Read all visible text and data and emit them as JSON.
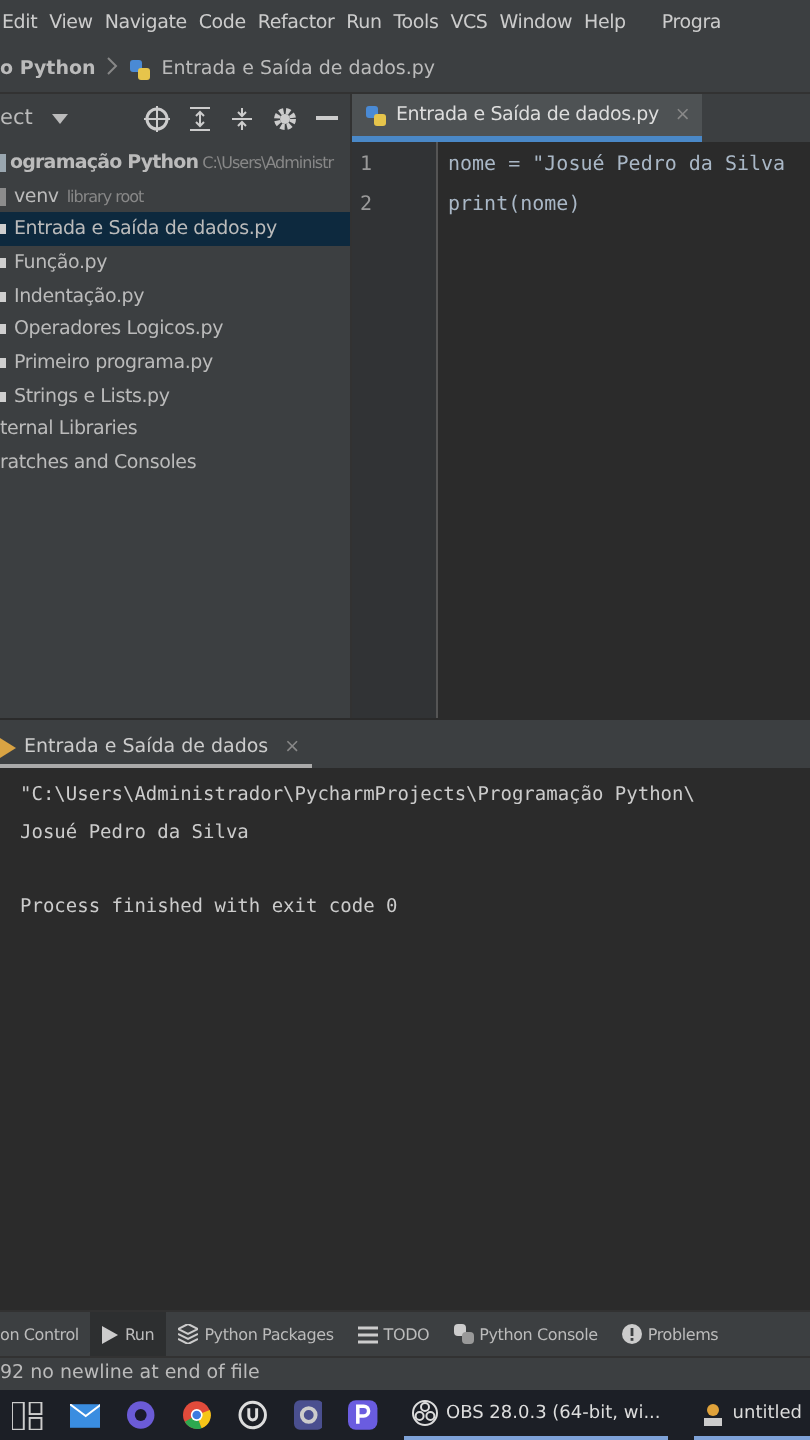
{
  "menu": [
    "Edit",
    "View",
    "Navigate",
    "Code",
    "Refactor",
    "Run",
    "Tools",
    "VCS",
    "Window",
    "Help",
    "Progra"
  ],
  "breadcrumb": {
    "project": "o Python",
    "file": "Entrada e Saída de dados.py"
  },
  "project_panel": {
    "dropdown": "ect",
    "tree": [
      {
        "label": "ogramação Python",
        "hint": "C:\\Users\\Administr",
        "kind": "folder",
        "expanded": true,
        "selected": false,
        "children": [
          {
            "label": "venv",
            "hint": "library root",
            "kind": "folder",
            "expanded": false,
            "selected": false
          },
          {
            "label": "Entrada e Saída de dados.py",
            "kind": "file",
            "selected": true
          },
          {
            "label": "Função.py",
            "kind": "file",
            "selected": false
          },
          {
            "label": "Indentação.py",
            "kind": "file",
            "selected": false
          },
          {
            "label": "Operadores Logicos.py",
            "kind": "file",
            "selected": false
          },
          {
            "label": "Primeiro programa.py",
            "kind": "file",
            "selected": false
          },
          {
            "label": "Strings e Lists.py",
            "kind": "file",
            "selected": false
          }
        ]
      },
      {
        "label": "ternal Libraries",
        "kind": "plain",
        "selected": false
      },
      {
        "label": "ratches and Consoles",
        "kind": "plain",
        "selected": false
      }
    ]
  },
  "editor": {
    "tab": "Entrada e Saída de dados.py",
    "close": "×",
    "lines": [
      {
        "number": "1",
        "code": "nome = \"Josué Pedro da Silva"
      },
      {
        "number": "2",
        "code": "print(nome)"
      }
    ]
  },
  "run_panel": {
    "tab": "Entrada e Saída de dados",
    "close": "×",
    "output": [
      "\"C:\\Users\\Administrador\\PycharmProjects\\Programação Python\\",
      "Josué Pedro da Silva",
      "Process finished with exit code 0"
    ]
  },
  "tool_tabs": [
    {
      "label": "on Control",
      "kind": "none",
      "selected": false
    },
    {
      "label": "Run",
      "kind": "run",
      "selected": true
    },
    {
      "label": "Python Packages",
      "kind": "layers",
      "selected": false
    },
    {
      "label": "TODO",
      "kind": "list",
      "selected": false
    },
    {
      "label": "Python Console",
      "kind": "python",
      "selected": false
    },
    {
      "label": "Problems",
      "kind": "alert",
      "selected": false
    }
  ],
  "status_bar": "92 no newline at end of file",
  "taskbar": {
    "windows": [
      {
        "label": "OBS 28.0.3 (64-bit, wi...",
        "kind": "obs"
      },
      {
        "label": "untitled",
        "kind": "doc"
      }
    ]
  }
}
